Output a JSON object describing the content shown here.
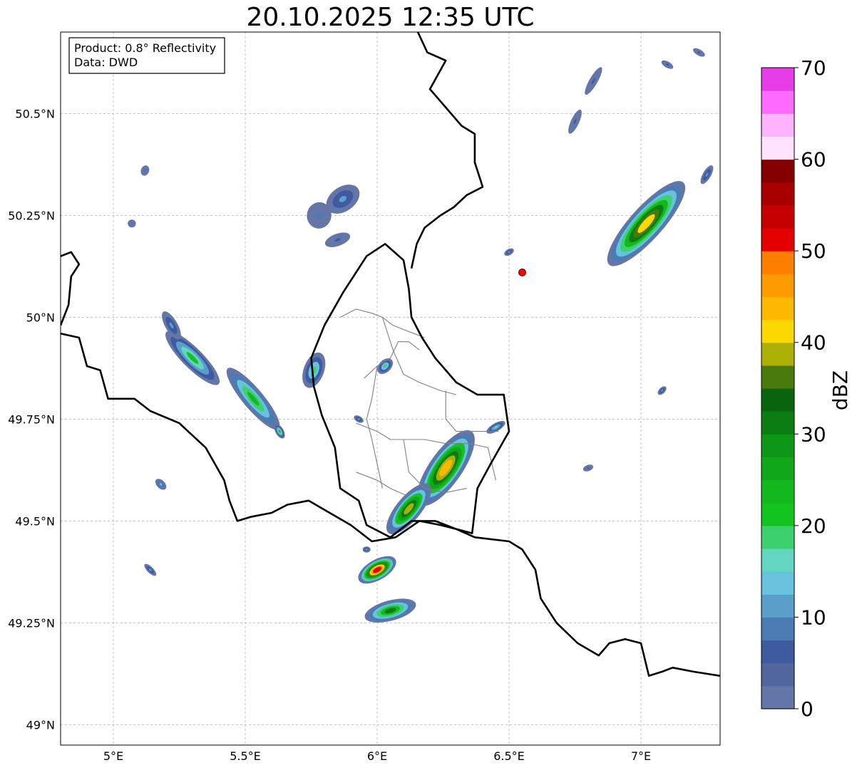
{
  "title": "20.10.2025 12:35 UTC",
  "infobox": {
    "product": "Product: 0.8° Reflectivity",
    "data": "Data: DWD"
  },
  "map": {
    "lon_range": [
      4.8,
      7.3
    ],
    "lat_range": [
      48.95,
      50.7
    ],
    "lon_ticks": [
      {
        "value": 5.0,
        "label": "5°E"
      },
      {
        "value": 5.5,
        "label": "5.5°E"
      },
      {
        "value": 6.0,
        "label": "6°E"
      },
      {
        "value": 6.5,
        "label": "6.5°E"
      },
      {
        "value": 7.0,
        "label": "7°E"
      }
    ],
    "lat_ticks": [
      {
        "value": 50.5,
        "label": "50.5°N"
      },
      {
        "value": 50.25,
        "label": "50.25°N"
      },
      {
        "value": 50.0,
        "label": "50°N"
      },
      {
        "value": 49.75,
        "label": "49.75°N"
      },
      {
        "value": 49.5,
        "label": "49.5°N"
      },
      {
        "value": 49.25,
        "label": "49.25°N"
      },
      {
        "value": 49.0,
        "label": "49°N"
      }
    ],
    "gridlines": true,
    "radar_site": {
      "lon": 6.55,
      "lat": 50.11,
      "color": "#ff0000"
    }
  },
  "colorbar": {
    "label": "dBZ",
    "min": 0,
    "max": 70,
    "step": 2.5,
    "tick_labels": [
      "0",
      "10",
      "20",
      "30",
      "40",
      "50",
      "60",
      "70"
    ],
    "colors": [
      "#6475a7",
      "#52669e",
      "#3f5a9f",
      "#4a7cb3",
      "#5a9fc9",
      "#68c1dd",
      "#63d6c2",
      "#3dd06f",
      "#12c41d",
      "#12b91d",
      "#10a81a",
      "#0e9617",
      "#0b7d13",
      "#0a650f",
      "#497a0b",
      "#acb005",
      "#fbd800",
      "#fdb900",
      "#fd9b00",
      "#fc7f00",
      "#e40000",
      "#c60000",
      "#a80000",
      "#840000",
      "#fee2fe",
      "#feb3fe",
      "#fd6bfe",
      "#e83ce8"
    ]
  },
  "borders": {
    "country": [
      [
        [
          4.8,
          50.15
        ],
        [
          4.84,
          50.16
        ],
        [
          4.87,
          50.13
        ],
        [
          4.84,
          50.1
        ],
        [
          4.83,
          50.03
        ],
        [
          4.8,
          49.98
        ]
      ],
      [
        [
          4.8,
          49.96
        ],
        [
          4.87,
          49.95
        ],
        [
          4.9,
          49.88
        ],
        [
          4.95,
          49.87
        ],
        [
          4.98,
          49.8
        ],
        [
          5.08,
          49.8
        ],
        [
          5.14,
          49.77
        ],
        [
          5.25,
          49.74
        ],
        [
          5.3,
          49.71
        ],
        [
          5.35,
          49.68
        ],
        [
          5.42,
          49.6
        ],
        [
          5.44,
          49.55
        ],
        [
          5.47,
          49.5
        ],
        [
          5.52,
          49.51
        ],
        [
          5.6,
          49.52
        ],
        [
          5.66,
          49.54
        ],
        [
          5.74,
          49.55
        ],
        [
          5.82,
          49.52
        ],
        [
          5.9,
          49.49
        ],
        [
          5.98,
          49.45
        ],
        [
          6.07,
          49.46
        ],
        [
          6.16,
          49.5
        ],
        [
          6.24,
          49.49
        ],
        [
          6.3,
          49.48
        ],
        [
          6.37,
          49.46
        ],
        [
          6.5,
          49.45
        ],
        [
          6.55,
          49.43
        ],
        [
          6.6,
          49.38
        ],
        [
          6.62,
          49.31
        ],
        [
          6.68,
          49.25
        ],
        [
          6.76,
          49.2
        ],
        [
          6.84,
          49.17
        ],
        [
          6.88,
          49.2
        ],
        [
          6.94,
          49.21
        ],
        [
          7.0,
          49.2
        ],
        [
          7.03,
          49.12
        ],
        [
          7.08,
          49.13
        ],
        [
          7.12,
          49.14
        ],
        [
          7.2,
          49.13
        ],
        [
          7.3,
          49.12
        ]
      ],
      [
        [
          5.8,
          49.98
        ],
        [
          5.87,
          50.06
        ],
        [
          5.96,
          50.15
        ],
        [
          6.03,
          50.18
        ],
        [
          6.1,
          50.14
        ],
        [
          6.12,
          50.07
        ],
        [
          6.13,
          50.0
        ],
        [
          6.17,
          49.95
        ],
        [
          6.22,
          49.9
        ],
        [
          6.3,
          49.84
        ],
        [
          6.38,
          49.81
        ],
        [
          6.48,
          49.81
        ],
        [
          6.5,
          49.72
        ],
        [
          6.43,
          49.64
        ],
        [
          6.38,
          49.58
        ],
        [
          6.36,
          49.47
        ],
        [
          6.3,
          49.48
        ],
        [
          6.22,
          49.5
        ],
        [
          6.13,
          49.5
        ],
        [
          6.05,
          49.46
        ],
        [
          5.96,
          49.49
        ],
        [
          5.93,
          49.55
        ],
        [
          5.86,
          49.58
        ],
        [
          5.84,
          49.68
        ],
        [
          5.79,
          49.76
        ],
        [
          5.76,
          49.83
        ],
        [
          5.75,
          49.9
        ],
        [
          5.8,
          49.98
        ]
      ],
      [
        [
          6.14,
          50.72
        ],
        [
          6.19,
          50.65
        ],
        [
          6.26,
          50.63
        ],
        [
          6.2,
          50.56
        ],
        [
          6.28,
          50.5
        ],
        [
          6.32,
          50.47
        ],
        [
          6.37,
          50.45
        ],
        [
          6.37,
          50.38
        ],
        [
          6.4,
          50.32
        ],
        [
          6.34,
          50.3
        ],
        [
          6.29,
          50.27
        ],
        [
          6.24,
          50.25
        ],
        [
          6.18,
          50.22
        ],
        [
          6.15,
          50.18
        ],
        [
          6.13,
          50.12
        ]
      ]
    ],
    "district": [
      [
        [
          5.86,
          50.0
        ],
        [
          5.92,
          50.02
        ],
        [
          5.98,
          50.01
        ],
        [
          6.02,
          50.0
        ],
        [
          6.06,
          49.98
        ],
        [
          6.1,
          49.97
        ],
        [
          6.14,
          49.96
        ],
        [
          6.18,
          49.95
        ]
      ],
      [
        [
          5.95,
          49.85
        ],
        [
          6.0,
          49.88
        ],
        [
          6.05,
          49.9
        ],
        [
          6.08,
          49.94
        ],
        [
          6.12,
          49.94
        ],
        [
          6.16,
          49.92
        ]
      ],
      [
        [
          6.02,
          50.0
        ],
        [
          6.06,
          49.92
        ],
        [
          6.1,
          49.86
        ],
        [
          6.16,
          49.84
        ],
        [
          6.24,
          49.82
        ],
        [
          6.3,
          49.81
        ]
      ],
      [
        [
          5.92,
          49.74
        ],
        [
          6.0,
          49.72
        ],
        [
          6.05,
          49.7
        ],
        [
          6.1,
          49.7
        ],
        [
          6.18,
          49.7
        ],
        [
          6.26,
          49.69
        ],
        [
          6.35,
          49.69
        ],
        [
          6.42,
          49.68
        ],
        [
          6.45,
          49.6
        ]
      ],
      [
        [
          6.0,
          49.88
        ],
        [
          5.98,
          49.8
        ],
        [
          5.96,
          49.75
        ],
        [
          5.98,
          49.7
        ],
        [
          6.0,
          49.64
        ],
        [
          6.02,
          49.58
        ]
      ],
      [
        [
          6.1,
          49.7
        ],
        [
          6.12,
          49.62
        ],
        [
          6.18,
          49.58
        ],
        [
          6.26,
          49.57
        ],
        [
          6.34,
          49.58
        ]
      ],
      [
        [
          5.92,
          49.62
        ],
        [
          6.0,
          49.6
        ],
        [
          6.05,
          49.58
        ],
        [
          6.12,
          49.56
        ]
      ],
      [
        [
          6.26,
          49.82
        ],
        [
          6.26,
          49.75
        ],
        [
          6.3,
          49.72
        ],
        [
          6.38,
          49.72
        ],
        [
          6.46,
          49.72
        ]
      ]
    ]
  },
  "echoes": [
    {
      "lon": 6.26,
      "lat": 49.63,
      "len": 0.34,
      "wid": 0.08,
      "angle": 55,
      "peak": 44
    },
    {
      "lon": 6.12,
      "lat": 49.53,
      "len": 0.24,
      "wid": 0.06,
      "angle": 50,
      "peak": 38
    },
    {
      "lon": 6.0,
      "lat": 49.38,
      "len": 0.16,
      "wid": 0.05,
      "angle": 30,
      "peak": 52
    },
    {
      "lon": 6.05,
      "lat": 49.28,
      "len": 0.2,
      "wid": 0.05,
      "angle": 15,
      "peak": 30
    },
    {
      "lon": 7.02,
      "lat": 50.23,
      "len": 0.42,
      "wid": 0.08,
      "angle": 48,
      "peak": 42
    },
    {
      "lon": 5.3,
      "lat": 49.9,
      "len": 0.28,
      "wid": 0.05,
      "angle": -45,
      "peak": 22
    },
    {
      "lon": 5.53,
      "lat": 49.8,
      "len": 0.3,
      "wid": 0.05,
      "angle": -50,
      "peak": 24
    },
    {
      "lon": 5.22,
      "lat": 49.98,
      "len": 0.12,
      "wid": 0.03,
      "angle": -60,
      "peak": 12
    },
    {
      "lon": 5.87,
      "lat": 50.29,
      "len": 0.14,
      "wid": 0.06,
      "angle": 35,
      "peak": 10
    },
    {
      "lon": 5.78,
      "lat": 50.25,
      "len": 0.1,
      "wid": 0.06,
      "angle": 80,
      "peak": 8
    },
    {
      "lon": 5.85,
      "lat": 50.19,
      "len": 0.1,
      "wid": 0.03,
      "angle": 20,
      "peak": 7
    },
    {
      "lon": 5.76,
      "lat": 49.87,
      "len": 0.14,
      "wid": 0.05,
      "angle": 70,
      "peak": 18
    },
    {
      "lon": 6.03,
      "lat": 49.88,
      "len": 0.07,
      "wid": 0.03,
      "angle": 45,
      "peak": 18
    },
    {
      "lon": 6.75,
      "lat": 50.48,
      "len": 0.1,
      "wid": 0.02,
      "angle": 65,
      "peak": 7
    },
    {
      "lon": 6.82,
      "lat": 50.58,
      "len": 0.12,
      "wid": 0.02,
      "angle": 60,
      "peak": 7
    },
    {
      "lon": 7.25,
      "lat": 50.35,
      "len": 0.08,
      "wid": 0.02,
      "angle": 60,
      "peak": 12
    },
    {
      "lon": 5.63,
      "lat": 49.72,
      "len": 0.06,
      "wid": 0.02,
      "angle": -60,
      "peak": 22
    },
    {
      "lon": 5.18,
      "lat": 49.59,
      "len": 0.05,
      "wid": 0.02,
      "angle": -45,
      "peak": 14
    },
    {
      "lon": 6.45,
      "lat": 49.73,
      "len": 0.08,
      "wid": 0.02,
      "angle": 30,
      "peak": 16
    },
    {
      "lon": 5.14,
      "lat": 49.38,
      "len": 0.06,
      "wid": 0.015,
      "angle": -45,
      "peak": 12
    },
    {
      "lon": 6.8,
      "lat": 49.63,
      "len": 0.04,
      "wid": 0.015,
      "angle": 20,
      "peak": 7
    },
    {
      "lon": 7.08,
      "lat": 49.82,
      "len": 0.04,
      "wid": 0.015,
      "angle": 45,
      "peak": 10
    },
    {
      "lon": 5.12,
      "lat": 50.36,
      "len": 0.04,
      "wid": 0.02,
      "angle": 70,
      "peak": 8
    },
    {
      "lon": 5.07,
      "lat": 50.23,
      "len": 0.03,
      "wid": 0.02,
      "angle": 80,
      "peak": 8
    },
    {
      "lon": 5.93,
      "lat": 49.75,
      "len": 0.04,
      "wid": 0.015,
      "angle": -30,
      "peak": 10
    },
    {
      "lon": 5.96,
      "lat": 49.43,
      "len": 0.03,
      "wid": 0.015,
      "angle": 0,
      "peak": 10
    },
    {
      "lon": 6.5,
      "lat": 50.16,
      "len": 0.04,
      "wid": 0.015,
      "angle": 30,
      "peak": 10
    },
    {
      "lon": 7.1,
      "lat": 50.62,
      "len": 0.05,
      "wid": 0.015,
      "angle": -30,
      "peak": 7
    },
    {
      "lon": 7.22,
      "lat": 50.65,
      "len": 0.05,
      "wid": 0.015,
      "angle": -30,
      "peak": 7
    }
  ]
}
